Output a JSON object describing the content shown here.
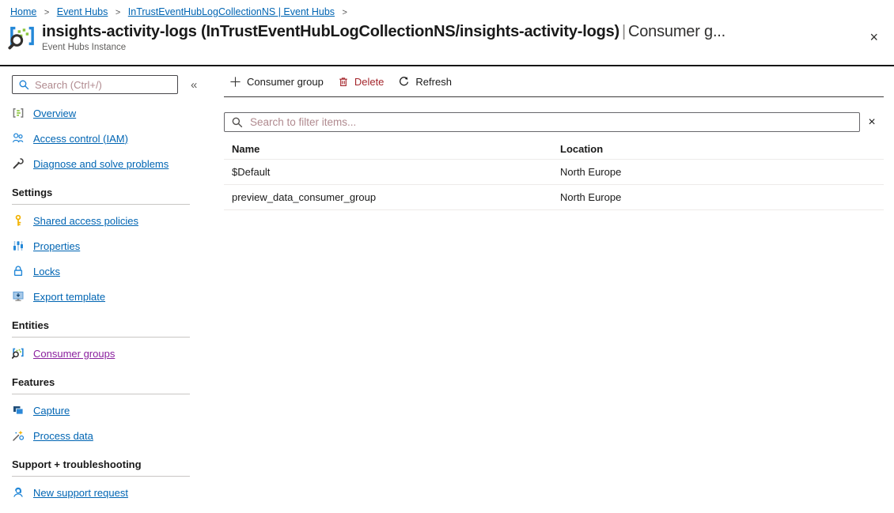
{
  "breadcrumb": {
    "separator": ">",
    "items": [
      {
        "label": "Home"
      },
      {
        "label": "Event Hubs"
      },
      {
        "label": "InTrustEventHubLogCollectionNS | Event Hubs"
      }
    ]
  },
  "header": {
    "icon": "event-hubs-instance-icon",
    "title_strong": "insights-activity-logs (InTrustEventHubLogCollectionNS/insights-activity-logs)",
    "title_pipe": "|",
    "title_suffix": "Consumer g...",
    "subtitle": "Event Hubs Instance",
    "close_icon": "×"
  },
  "sidebar": {
    "search_placeholder": "Search (Ctrl+/)",
    "search_icon": "search-icon",
    "collapse_icon": "«",
    "groups": [
      {
        "items": [
          {
            "label": "Overview",
            "icon": "overview-icon"
          },
          {
            "label": "Access control (IAM)",
            "icon": "people-icon"
          },
          {
            "label": "Diagnose and solve problems",
            "icon": "wrench-icon"
          }
        ]
      },
      {
        "header": "Settings",
        "items": [
          {
            "label": "Shared access policies",
            "icon": "key-icon"
          },
          {
            "label": "Properties",
            "icon": "sliders-icon"
          },
          {
            "label": "Locks",
            "icon": "lock-icon"
          },
          {
            "label": "Export template",
            "icon": "export-template-icon"
          }
        ]
      },
      {
        "header": "Entities",
        "items": [
          {
            "label": "Consumer groups",
            "icon": "consumer-groups-icon",
            "active": true
          }
        ]
      },
      {
        "header": "Features",
        "items": [
          {
            "label": "Capture",
            "icon": "capture-icon"
          },
          {
            "label": "Process data",
            "icon": "process-data-icon"
          }
        ]
      },
      {
        "header": "Support + troubleshooting",
        "items": [
          {
            "label": "New support request",
            "icon": "headset-icon"
          }
        ]
      }
    ]
  },
  "commandbar": {
    "items": [
      {
        "label": "Consumer group",
        "icon": "plus-icon"
      },
      {
        "label": "Delete",
        "icon": "trash-icon"
      },
      {
        "label": "Refresh",
        "icon": "refresh-icon"
      }
    ]
  },
  "filter": {
    "placeholder": "Search to filter items...",
    "search_icon": "search-icon",
    "clear_icon": "×"
  },
  "table": {
    "columns": {
      "name": "Name",
      "location": "Location"
    },
    "rows": [
      {
        "name": "$Default",
        "location": "North Europe"
      },
      {
        "name": "preview_data_consumer_group",
        "location": "North Europe"
      }
    ]
  },
  "colors": {
    "link_blue": "#0065b3",
    "active_link_purple": "#8a1f9e",
    "delete_red": "#a4262c",
    "accent_blue": "#2488d8",
    "event_hub_green": "#8cc63f",
    "key_yellow": "#f2b200",
    "placeholder_rose": "#b08a8f",
    "header_rule": "#161616",
    "row_rule": "#edebe9",
    "section_rule": "#c8c6c4"
  }
}
